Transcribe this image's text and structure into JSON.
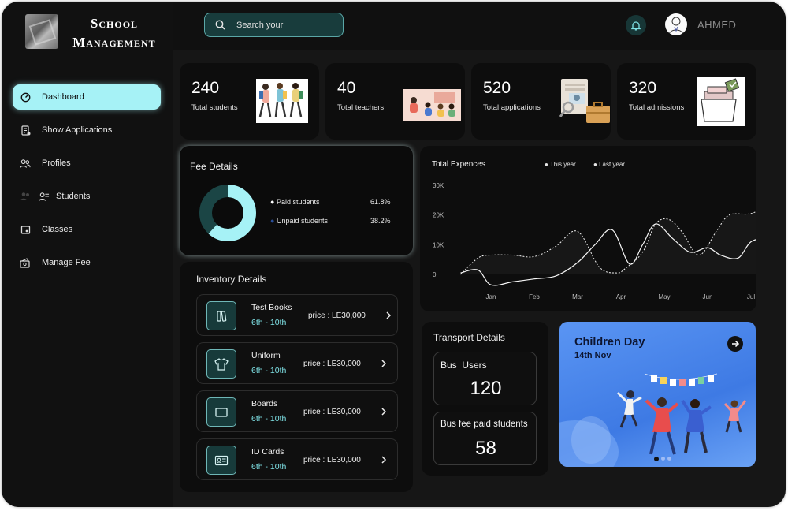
{
  "brand": {
    "line1": "School",
    "line2": "Management"
  },
  "nav": [
    {
      "label": "Dashboard",
      "icon": "dashboard-icon",
      "active": true
    },
    {
      "label": "Show Applications",
      "icon": "applications-icon"
    },
    {
      "label": "Profiles",
      "icon": "profiles-icon"
    },
    {
      "label": "Students",
      "icon": "students-icon"
    },
    {
      "label": "Classes",
      "icon": "classes-icon"
    },
    {
      "label": "Manage Fee",
      "icon": "fee-icon"
    }
  ],
  "search": {
    "placeholder": "Search your"
  },
  "user": {
    "name": "AHMED"
  },
  "stats": [
    {
      "value": "240",
      "label": "Total students"
    },
    {
      "value": "40",
      "label": "Total teachers"
    },
    {
      "value": "520",
      "label": "Total applications"
    },
    {
      "value": "320",
      "label": "Total admissions"
    }
  ],
  "fee": {
    "title": "Fee Details",
    "paid_label": "Paid students",
    "paid_value": "61.8%",
    "paid_fraction": 0.618,
    "unpaid_label": "Unpaid students",
    "unpaid_value": "38.2%",
    "unpaid_fraction": 0.382,
    "paid_color": "#a6f2f6",
    "unpaid_color": "#1b4545"
  },
  "inventory": {
    "title": "Inventory Details",
    "items": [
      {
        "name": "Test Books",
        "grade": "6th - 10th",
        "price": "price : LE30,000",
        "icon": "books-icon"
      },
      {
        "name": "Uniform",
        "grade": "6th - 10th",
        "price": "price : LE30,000",
        "icon": "tshirt-icon"
      },
      {
        "name": "Boards",
        "grade": "6th - 10th",
        "price": "price : LE30,000",
        "icon": "board-icon"
      },
      {
        "name": "ID Cards",
        "grade": "6th - 10th",
        "price": "price : LE30,000",
        "icon": "id-card-icon"
      }
    ]
  },
  "chart_data": {
    "type": "line",
    "title": "Total Expences",
    "categories": [
      "Jan",
      "Feb",
      "Mar",
      "Apr",
      "May",
      "Jun",
      "Jul"
    ],
    "yticks": [
      "30K",
      "20K",
      "10K",
      "0"
    ],
    "ylim": [
      0,
      30000
    ],
    "legend_placement": "top",
    "series": [
      {
        "name": "This year",
        "style": "solid",
        "x": [
          -0.7,
          -0.3,
          0.0,
          0.5,
          1.0,
          1.5,
          2.0,
          2.4,
          2.8,
          3.2,
          3.5,
          3.8,
          4.2,
          4.6,
          5.0,
          5.3,
          5.7,
          6.0,
          6.4
        ],
        "values": [
          500,
          1500,
          -3500,
          -2500,
          -1500,
          -500,
          4000,
          10000,
          15000,
          3500,
          10000,
          17000,
          12000,
          7500,
          9000,
          6500,
          5500,
          11000,
          12500
        ]
      },
      {
        "name": "Last year",
        "style": "dashed",
        "x": [
          -0.7,
          -0.3,
          0.0,
          0.5,
          1.0,
          1.5,
          2.0,
          2.5,
          2.9,
          3.1,
          3.5,
          3.8,
          4.1,
          4.4,
          4.8,
          5.2,
          5.5,
          6.0,
          6.5
        ],
        "values": [
          0,
          5500,
          6500,
          6500,
          6000,
          9500,
          14500,
          2500,
          500,
          2000,
          7500,
          17000,
          18500,
          14500,
          6500,
          14500,
          20000,
          20500,
          24000
        ]
      }
    ]
  },
  "transport": {
    "title": "Transport Details",
    "bus_users_label": "Bus  Users",
    "bus_users_value": "120",
    "bus_fee_label": "Bus fee paid students",
    "bus_fee_value": "58"
  },
  "event": {
    "title": "Children Day",
    "date": "14th Nov",
    "bg_color": "#4c86ee"
  }
}
